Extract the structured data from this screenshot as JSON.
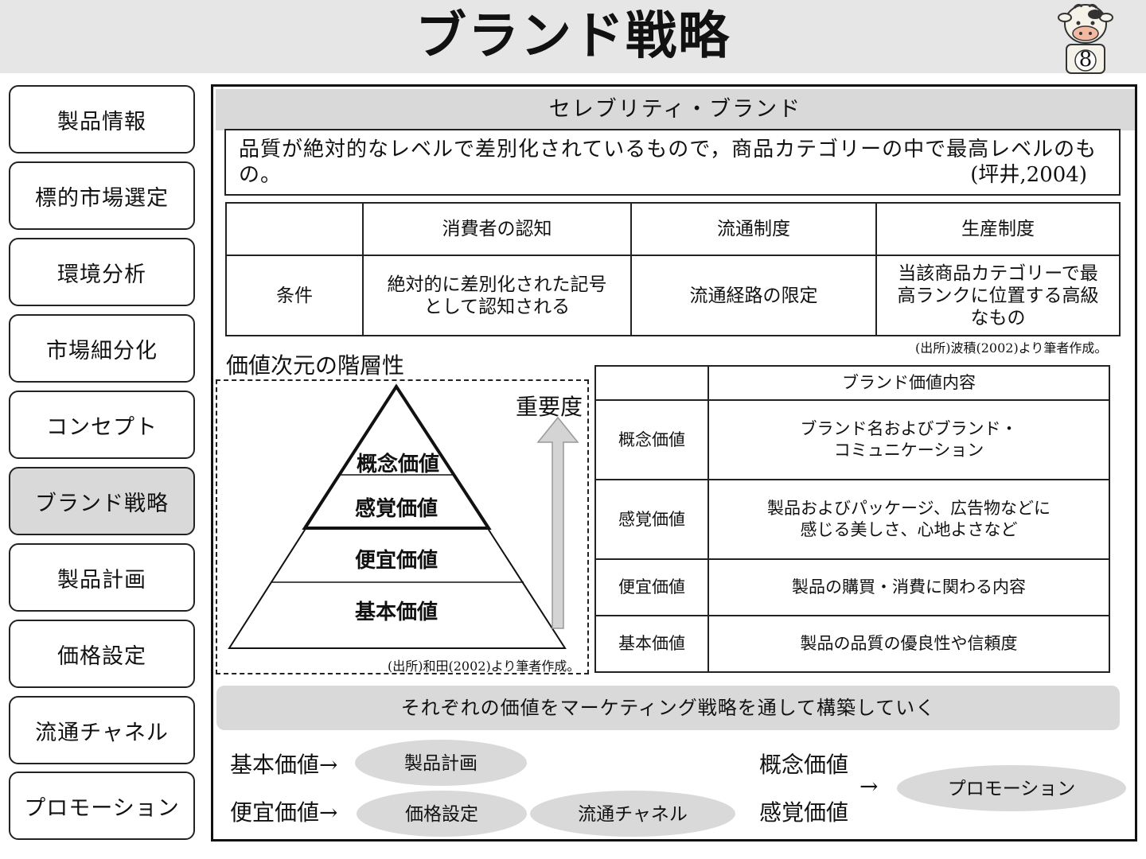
{
  "header": {
    "title": "ブランド戦略",
    "page_number": "8"
  },
  "sidebar": {
    "items": [
      {
        "label": "製品情報"
      },
      {
        "label": "標的市場選定"
      },
      {
        "label": "環境分析"
      },
      {
        "label": "市場細分化"
      },
      {
        "label": "コンセプト"
      },
      {
        "label": "ブランド戦略",
        "active": true
      },
      {
        "label": "製品計画"
      },
      {
        "label": "価格設定"
      },
      {
        "label": "流通チャネル"
      },
      {
        "label": "プロモーション"
      }
    ]
  },
  "main": {
    "section_title": "セレブリティ・ブランド",
    "definition": "品質が絶対的なレベルで差別化されているもので，商品カテゴリーの中で最高レベルのもの。",
    "definition_cite": "(坪井,2004)",
    "conditions_table": {
      "headers": [
        "",
        "消費者の認知",
        "流通制度",
        "生産制度"
      ],
      "row": [
        "条件",
        "絶対的に差別化された記号\nとして認知される",
        "流通経路の限定",
        "当該商品カテゴリーで最\n高ランクに位置する高級\nなもの"
      ],
      "source": "(出所)波積(2002)より筆者作成。"
    },
    "hierarchy": {
      "title": "価値次元の階層性",
      "levels": [
        "概念価値",
        "感覚価値",
        "便宜価値",
        "基本価値"
      ],
      "arrow_label": "重要度",
      "source": "(出所)和田(2002)より筆者作成。"
    },
    "value_table": {
      "header": [
        "",
        "ブランド価値内容"
      ],
      "rows": [
        [
          "概念価値",
          "ブランド名およびブランド・\nコミュニケーション"
        ],
        [
          "感覚価値",
          "製品およびパッケージ、広告物などに\n感じる美しさ、心地よさなど"
        ],
        [
          "便宜価値",
          "製品の購買・消費に関わる内容"
        ],
        [
          "基本価値",
          "製品の品質の優良性や信頼度"
        ]
      ]
    },
    "banner": "それぞれの価値をマーケティング戦略を通して構築していく",
    "mapping": {
      "basic_label": "基本価値→",
      "basic_pills": [
        "製品計画"
      ],
      "convenience_label": "便宜価値→",
      "convenience_pills": [
        "価格設定",
        "流通チャネル"
      ],
      "concept_label": "概念価値",
      "sensory_label": "感覚価値",
      "arrow": "→",
      "promo_pill": "プロモーション"
    }
  },
  "colors": {
    "header_bg": "#e6e6e6",
    "panel_gray": "#d9d9d9",
    "border": "#222222"
  }
}
